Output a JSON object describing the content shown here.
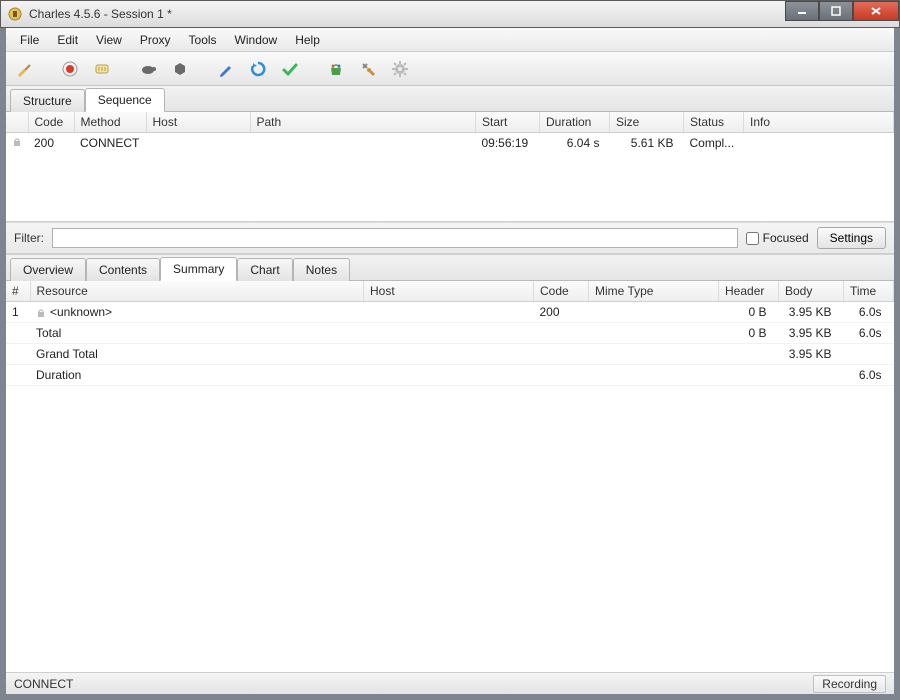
{
  "window": {
    "title": "Charles 4.5.6 - Session 1 *"
  },
  "menu": [
    "File",
    "Edit",
    "View",
    "Proxy",
    "Tools",
    "Window",
    "Help"
  ],
  "toolbar_icons": [
    "broom-icon",
    "record-icon",
    "throttle-icon",
    "turtle-icon",
    "hex-icon",
    "pen-icon",
    "refresh-icon",
    "check-icon",
    "basket-icon",
    "tools-icon",
    "gear-icon"
  ],
  "tabs_top": {
    "items": [
      "Structure",
      "Sequence"
    ],
    "active_index": 1
  },
  "sequence_table": {
    "columns": [
      "",
      "Code",
      "Method",
      "Host",
      "Path",
      "Start",
      "Duration",
      "Size",
      "Status",
      "Info"
    ],
    "rows": [
      {
        "icon": "lock",
        "code": "200",
        "method": "CONNECT",
        "host": "",
        "path": "",
        "start": "09:56:19",
        "duration": "6.04 s",
        "size": "5.61 KB",
        "status": "Compl...",
        "info": ""
      }
    ]
  },
  "filter": {
    "label": "Filter:",
    "value": "",
    "focused_label": "Focused",
    "focused_checked": false,
    "settings_label": "Settings"
  },
  "tabs_detail": {
    "items": [
      "Overview",
      "Contents",
      "Summary",
      "Chart",
      "Notes"
    ],
    "active_index": 2
  },
  "summary_table": {
    "columns": [
      "#",
      "Resource",
      "Host",
      "Code",
      "Mime Type",
      "Header",
      "Body",
      "Time"
    ],
    "rows": [
      {
        "num": "1",
        "resource": "<unknown>",
        "resource_icon": "lock",
        "host": "",
        "code": "200",
        "mime": "",
        "header": "0 B",
        "body": "3.95 KB",
        "time": "6.0s"
      },
      {
        "num": "",
        "resource": "Total",
        "host": "",
        "code": "",
        "mime": "",
        "header": "0 B",
        "body": "3.95 KB",
        "time": "6.0s"
      },
      {
        "num": "",
        "resource": "Grand Total",
        "host": "",
        "code": "",
        "mime": "",
        "header": "",
        "body": "3.95 KB",
        "time": ""
      },
      {
        "num": "",
        "resource": "Duration",
        "host": "",
        "code": "",
        "mime": "",
        "header": "",
        "body": "",
        "time": "6.0s"
      }
    ]
  },
  "statusbar": {
    "left": "CONNECT",
    "right": "Recording"
  }
}
